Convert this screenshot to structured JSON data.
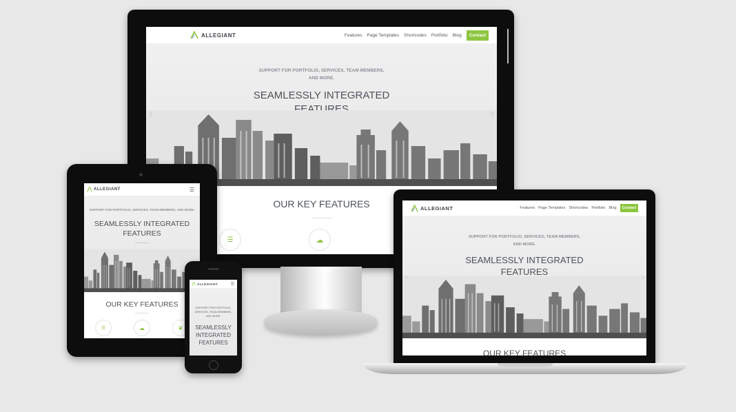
{
  "site": {
    "logo_text": "ALLEGIANT",
    "nav": {
      "features": "Features",
      "page_templates": "Page Templates",
      "shortcodes": "Shortcodes",
      "portfolio": "Portfolio",
      "blog": "Blog",
      "contact": "Contact"
    },
    "hero_sub": "SUPPORT FOR PORTFOLIO, SERVICES, TEAM MEMBERS, AND MORE.",
    "hero_sub_line1": "SUPPORT FOR PORTFOLIO, SERVICES, TEAM MEMBERS,",
    "hero_sub_line2": "AND MORE.",
    "hero_title_line1": "SEAMLESSLY INTEGRATED",
    "hero_title_line2": "FEATURES",
    "phone_sub_line1": "SUPPORT FOR PORTFOLIO,",
    "phone_sub_line2": "SERVICES, TEAM MEMBERS,",
    "phone_sub_line3": "AND MORE.",
    "phone_title_line1": "SEAMLESSLY",
    "phone_title_line2": "INTEGRATED",
    "phone_title_line3": "FEATURES",
    "section_title": "OUR KEY FEATURES"
  },
  "icons": {
    "layers": "layers-icon",
    "cloud": "cloud-icon",
    "leaf": "leaf-icon",
    "menu": "hamburger-menu-icon",
    "arrow_left": "chevron-left-icon",
    "arrow_right": "chevron-right-icon"
  },
  "colors": {
    "accent": "#8dc63f",
    "heading": "#4c5158",
    "background": "#e8e8e8",
    "bezel": "#0d0d0d"
  }
}
